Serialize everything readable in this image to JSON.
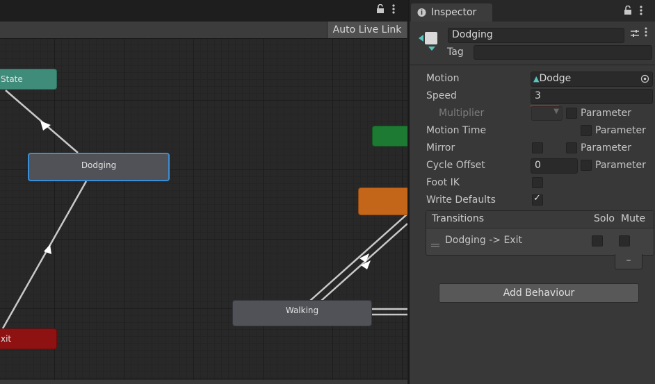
{
  "animator": {
    "auto_live_link": "Auto Live Link",
    "nodes": {
      "entry_state": "State",
      "dodging": "Dodging",
      "walking": "Walking",
      "exit": "xit"
    }
  },
  "inspector": {
    "tab_title": "Inspector",
    "state_name": "Dodging",
    "tag_label": "Tag",
    "tag_value": "",
    "rows": {
      "motion_label": "Motion",
      "motion_value": "Dodge",
      "speed_label": "Speed",
      "speed_value": "3",
      "multiplier_label": "Multiplier",
      "motion_time_label": "Motion Time",
      "mirror_label": "Mirror",
      "cycle_offset_label": "Cycle Offset",
      "cycle_offset_value": "0",
      "foot_ik_label": "Foot IK",
      "write_defaults_label": "Write Defaults",
      "parameter_label": "Parameter"
    },
    "checks": {
      "multiplier_param": false,
      "motion_time_param": false,
      "mirror": false,
      "mirror_param": false,
      "cycle_offset_param": false,
      "foot_ik": false,
      "write_defaults": true
    },
    "transitions": {
      "header": "Transitions",
      "solo_label": "Solo",
      "mute_label": "Mute",
      "items": [
        {
          "label": "Dodging -> Exit",
          "solo": false,
          "mute": false
        }
      ],
      "remove_label": "–"
    },
    "add_behaviour_label": "Add Behaviour"
  },
  "colors": {
    "entry_node": "#3f8c7a",
    "dodging_node": "#505257",
    "selected_outline": "#3a8fd6",
    "exit_node": "#8f1212",
    "green_node": "#1d7a32",
    "orange_node": "#c4661a",
    "speed_underline": "#c01818"
  }
}
